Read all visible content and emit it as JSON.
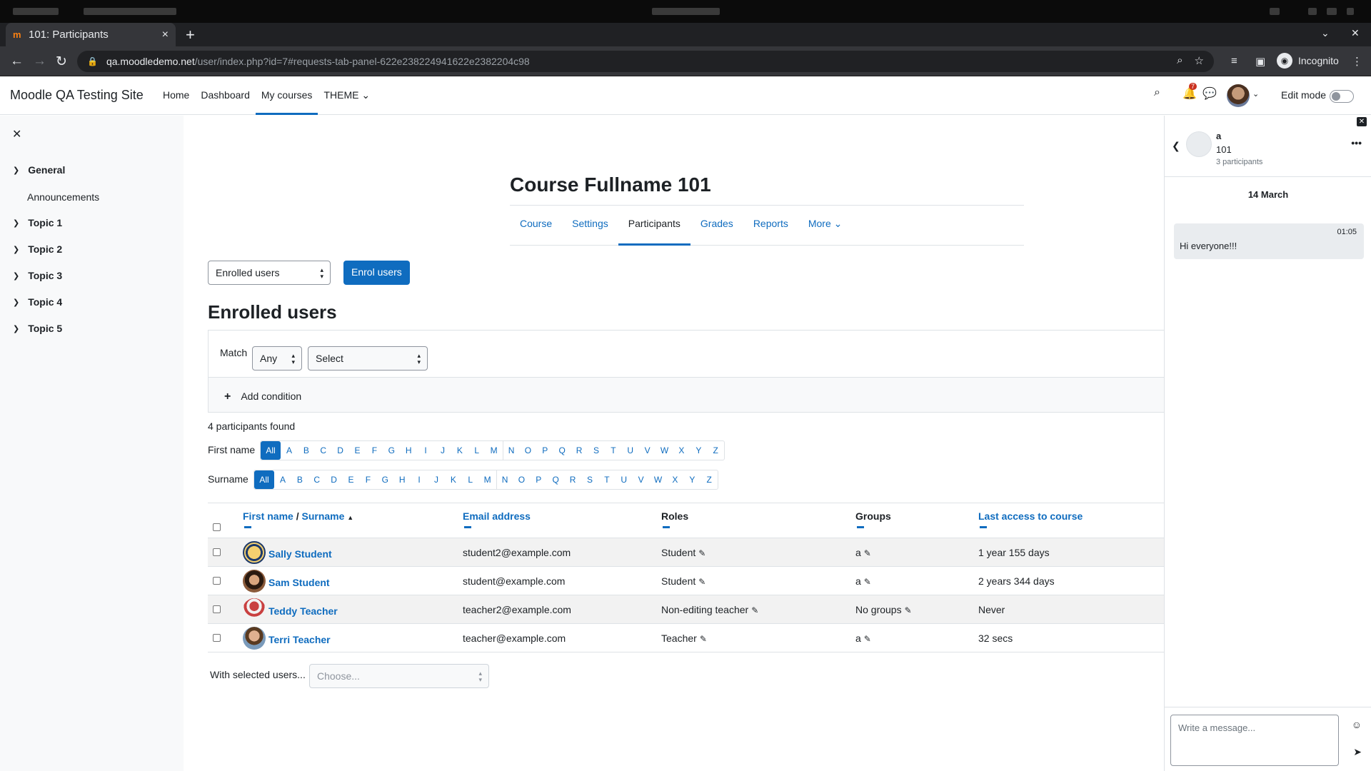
{
  "browser": {
    "tab_title": "101: Participants",
    "tab_favicon": "m",
    "url_host": "qa.moodledemo.net",
    "url_path": "/user/index.php?id=7#requests-tab-panel-622e238224941622e2382204c98",
    "incognito_label": "Incognito"
  },
  "navbar": {
    "brand": "Moodle QA Testing Site",
    "items": [
      {
        "label": "Home"
      },
      {
        "label": "Dashboard"
      },
      {
        "label": "My courses"
      },
      {
        "label": "THEME ⌄"
      }
    ],
    "notification_count": "7",
    "edit_mode_label": "Edit mode"
  },
  "course_index": {
    "sections": [
      {
        "label": "General",
        "items": [
          "Announcements"
        ]
      },
      {
        "label": "Topic 1"
      },
      {
        "label": "Topic 2"
      },
      {
        "label": "Topic 3"
      },
      {
        "label": "Topic 4"
      },
      {
        "label": "Topic 5"
      }
    ]
  },
  "course": {
    "title": "Course Fullname 101",
    "secondary_nav": [
      {
        "label": "Course"
      },
      {
        "label": "Settings"
      },
      {
        "label": "Participants"
      },
      {
        "label": "Grades"
      },
      {
        "label": "Reports"
      },
      {
        "label": "More ⌄"
      }
    ]
  },
  "participants": {
    "view_select": "Enrolled users",
    "enrol_button": "Enrol users",
    "heading": "Enrolled users",
    "filter": {
      "match_label": "Match",
      "match_value": "Any",
      "condition_value": "Select",
      "add_condition": "Add condition"
    },
    "found_text": "4 participants found",
    "firstname_label": "First name",
    "surname_label": "Surname",
    "initials": [
      "All",
      "A",
      "B",
      "C",
      "D",
      "E",
      "F",
      "G",
      "H",
      "I",
      "J",
      "K",
      "L",
      "M",
      "N",
      "O",
      "P",
      "Q",
      "R",
      "S",
      "T",
      "U",
      "V",
      "W",
      "X",
      "Y",
      "Z"
    ],
    "columns": {
      "firstname": "First name",
      "separator": "/",
      "surname": "Surname",
      "email": "Email address",
      "roles": "Roles",
      "groups": "Groups",
      "lastaccess": "Last access to course"
    },
    "rows": [
      {
        "name": "Sally Student",
        "email": "student2@example.com",
        "role": "Student",
        "group": "a",
        "access": "1 year 155 days"
      },
      {
        "name": "Sam Student",
        "email": "student@example.com",
        "role": "Student",
        "group": "a",
        "access": "2 years 344 days"
      },
      {
        "name": "Teddy Teacher",
        "email": "teacher2@example.com",
        "role": "Non-editing teacher",
        "group": "No groups",
        "access": "Never"
      },
      {
        "name": "Terri Teacher",
        "email": "teacher@example.com",
        "role": "Teacher",
        "group": "a",
        "access": "32 secs"
      }
    ],
    "with_selected_label": "With selected users...",
    "with_selected_placeholder": "Choose..."
  },
  "messaging": {
    "group_name": "a",
    "group_course": "101",
    "participant_count": "3 participants",
    "date": "14 March",
    "messages": [
      {
        "time": "01:05",
        "text": "Hi everyone!!!"
      }
    ],
    "input_placeholder": "Write a message..."
  }
}
